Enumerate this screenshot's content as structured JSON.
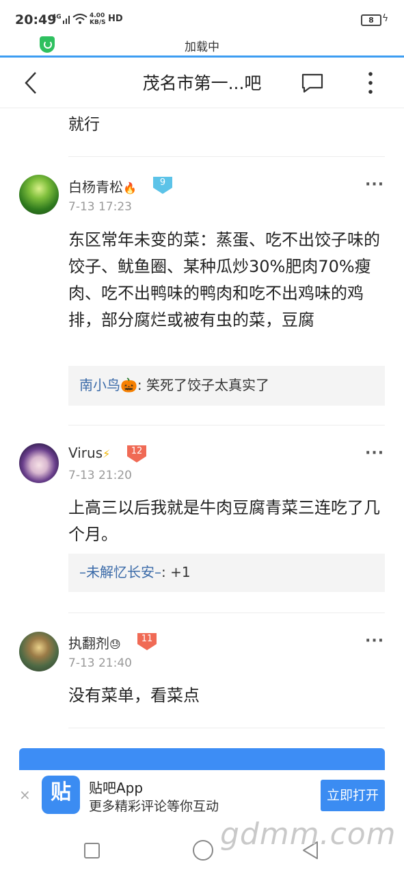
{
  "status_bar": {
    "time": "20:49",
    "signal": "4G",
    "speed_top": "4.00",
    "speed_bottom": "KB/S",
    "hd": "HD",
    "battery": "8"
  },
  "loading": {
    "text": "加载中"
  },
  "nav": {
    "title": "茂名市第一...吧"
  },
  "leftover_text": "就行",
  "posts": [
    {
      "username": "白杨青松",
      "user_emoji": "🔥",
      "level": "9",
      "time": "7-13 17:23",
      "body": "东区常年未变的菜：蒸蛋、吃不出饺子味的饺子、鱿鱼圈、某种瓜炒30%肥肉70%瘦肉、吃不出鸭味的鸭肉和吃不出鸡味的鸡排，部分腐烂或被有虫的菜，豆腐",
      "reply_name": "南小鸟🎃",
      "reply_text": ": 笑死了饺子太真实了",
      "more": "···"
    },
    {
      "username": "Virus",
      "user_emoji": "⚡",
      "level": "12",
      "time": "7-13 21:20",
      "body": "上高三以后我就是牛肉豆腐青菜三连吃了几个月。",
      "reply_name": "–未解忆长安–",
      "reply_text": ": +1",
      "more": "···"
    },
    {
      "username": "执翻剂",
      "user_emoji": "😓",
      "level": "11",
      "time": "7-13 21:40",
      "body": "没有菜单，看菜点",
      "more": "···"
    }
  ],
  "banner": {
    "close": "×",
    "logo_text": "贴",
    "app_name": "贴吧App",
    "app_sub": "更多精彩评论等你互动",
    "open_label": "立即打开"
  },
  "watermark": "gdmm.com",
  "colors": {
    "accent": "#3b8cf2",
    "reply_name": "#3a6aa8",
    "level_low": "#5cc3e8",
    "level_high": "#f06a55"
  }
}
